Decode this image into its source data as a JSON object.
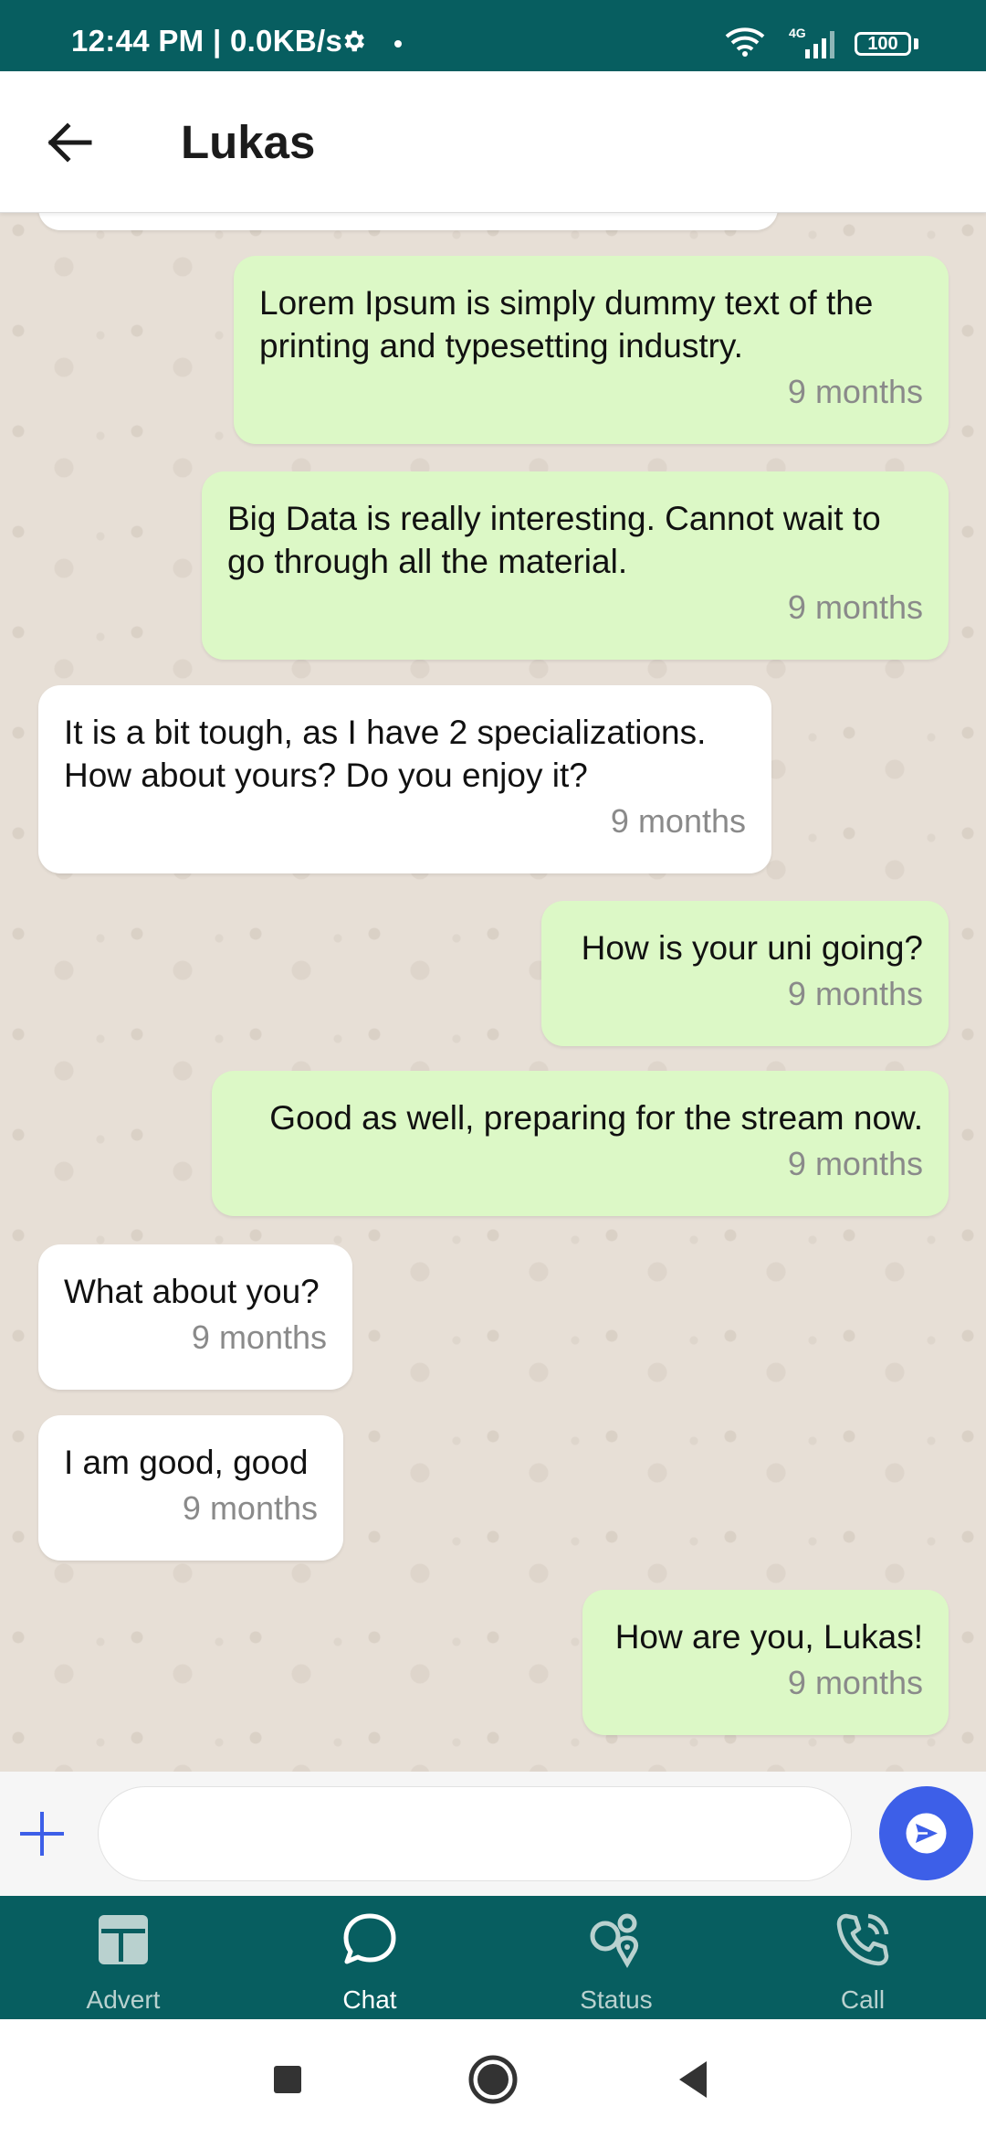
{
  "status_bar": {
    "time": "12:44 PM | 0.0KB/s",
    "network": "4G",
    "battery": "100"
  },
  "header": {
    "title": "Lukas"
  },
  "messages": [
    {
      "direction": "out",
      "text": "Lorem Ipsum is simply dummy text of the printing and typesetting industry.",
      "time": "9 months"
    },
    {
      "direction": "out",
      "text": "Big Data is really interesting. Cannot wait to go through all the material.",
      "time": "9 months"
    },
    {
      "direction": "in",
      "text": "It is a bit tough, as I have 2 specializations. How about yours? Do you enjoy it?",
      "time": "9 months"
    },
    {
      "direction": "out",
      "text": "How is your uni going?",
      "time": "9 months"
    },
    {
      "direction": "out",
      "text": "Good as well, preparing for the stream now.",
      "time": "9 months"
    },
    {
      "direction": "in",
      "text": "What about you?",
      "time": "9 months"
    },
    {
      "direction": "in",
      "text": "I am good, good",
      "time": "9 months"
    },
    {
      "direction": "out",
      "text": "How are you, Lukas!",
      "time": "9 months"
    }
  ],
  "composer": {
    "input_value": "",
    "input_placeholder": ""
  },
  "bottom_nav": {
    "items": [
      {
        "label": "Advert",
        "icon": "advert-icon",
        "active": false
      },
      {
        "label": "Chat",
        "icon": "chat-bubble-icon",
        "active": true
      },
      {
        "label": "Status",
        "icon": "status-icon",
        "active": false
      },
      {
        "label": "Call",
        "icon": "phone-icon",
        "active": false
      }
    ]
  },
  "colors": {
    "primary": "#075e60",
    "outgoing_bubble": "#dcf8c6",
    "incoming_bubble": "#ffffff",
    "send_button": "#3d5fe8",
    "chat_background": "#e7dfd6"
  }
}
